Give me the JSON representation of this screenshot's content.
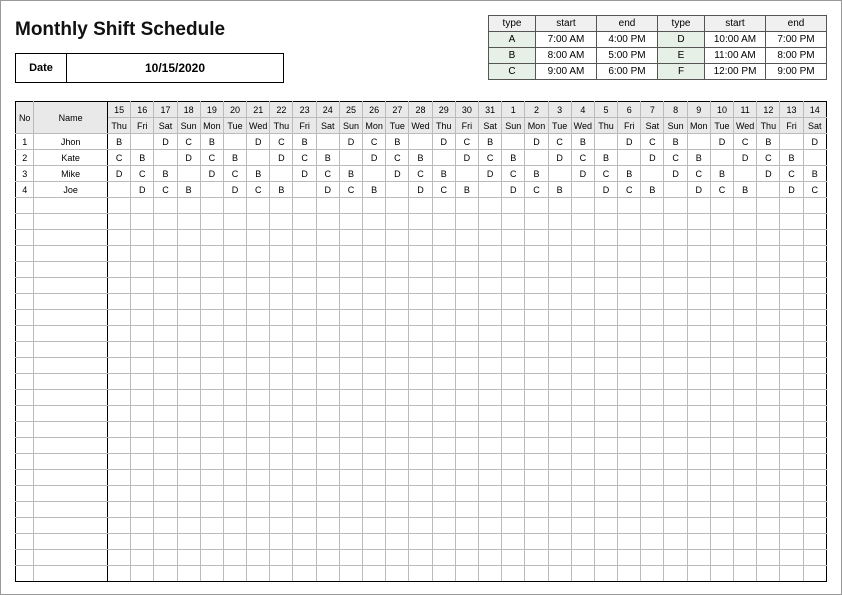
{
  "title": "Monthly Shift Schedule",
  "dateLabel": "Date",
  "dateValue": "10/15/2020",
  "shiftTypeHeaders": [
    "type",
    "start",
    "end",
    "type",
    "start",
    "end"
  ],
  "shiftTypeRows": [
    [
      "A",
      "7:00 AM",
      "4:00 PM",
      "D",
      "10:00 AM",
      "7:00 PM"
    ],
    [
      "B",
      "8:00 AM",
      "5:00 PM",
      "E",
      "11:00 AM",
      "8:00 PM"
    ],
    [
      "C",
      "9:00 AM",
      "6:00 PM",
      "F",
      "12:00 PM",
      "9:00 PM"
    ]
  ],
  "scheduleHeaders": {
    "no": "No",
    "name": "Name"
  },
  "dayNumbers": [
    "15",
    "16",
    "17",
    "18",
    "19",
    "20",
    "21",
    "22",
    "23",
    "24",
    "25",
    "26",
    "27",
    "28",
    "29",
    "30",
    "31",
    "1",
    "2",
    "3",
    "4",
    "5",
    "6",
    "7",
    "8",
    "9",
    "10",
    "11",
    "12",
    "13",
    "14"
  ],
  "dayOfWeek": [
    "Thu",
    "Fri",
    "Sat",
    "Sun",
    "Mon",
    "Tue",
    "Wed",
    "Thu",
    "Fri",
    "Sat",
    "Sun",
    "Mon",
    "Tue",
    "Wed",
    "Thu",
    "Fri",
    "Sat",
    "Sun",
    "Mon",
    "Tue",
    "Wed",
    "Thu",
    "Fri",
    "Sat",
    "Sun",
    "Mon",
    "Tue",
    "Wed",
    "Thu",
    "Fri",
    "Sat"
  ],
  "employees": [
    {
      "no": "1",
      "name": "Jhon",
      "shifts": [
        "B",
        "",
        "D",
        "C",
        "B",
        "",
        "D",
        "C",
        "B",
        "",
        "D",
        "C",
        "B",
        "",
        "D",
        "C",
        "B",
        "",
        "D",
        "C",
        "B",
        "",
        "D",
        "C",
        "B",
        "",
        "D",
        "C",
        "B",
        "",
        "D"
      ]
    },
    {
      "no": "2",
      "name": "Kate",
      "shifts": [
        "C",
        "B",
        "",
        "D",
        "C",
        "B",
        "",
        "D",
        "C",
        "B",
        "",
        "D",
        "C",
        "B",
        "",
        "D",
        "C",
        "B",
        "",
        "D",
        "C",
        "B",
        "",
        "D",
        "C",
        "B",
        "",
        "D",
        "C",
        "B",
        ""
      ]
    },
    {
      "no": "3",
      "name": "Mike",
      "shifts": [
        "D",
        "C",
        "B",
        "",
        "D",
        "C",
        "B",
        "",
        "D",
        "C",
        "B",
        "",
        "D",
        "C",
        "B",
        "",
        "D",
        "C",
        "B",
        "",
        "D",
        "C",
        "B",
        "",
        "D",
        "C",
        "B",
        "",
        "D",
        "C",
        "B"
      ]
    },
    {
      "no": "4",
      "name": "Joe",
      "shifts": [
        "",
        "D",
        "C",
        "B",
        "",
        "D",
        "C",
        "B",
        "",
        "D",
        "C",
        "B",
        "",
        "D",
        "C",
        "B",
        "",
        "D",
        "C",
        "B",
        "",
        "D",
        "C",
        "B",
        "",
        "D",
        "C",
        "B",
        "",
        "D",
        "C"
      ]
    }
  ],
  "emptyRowCount": 24
}
